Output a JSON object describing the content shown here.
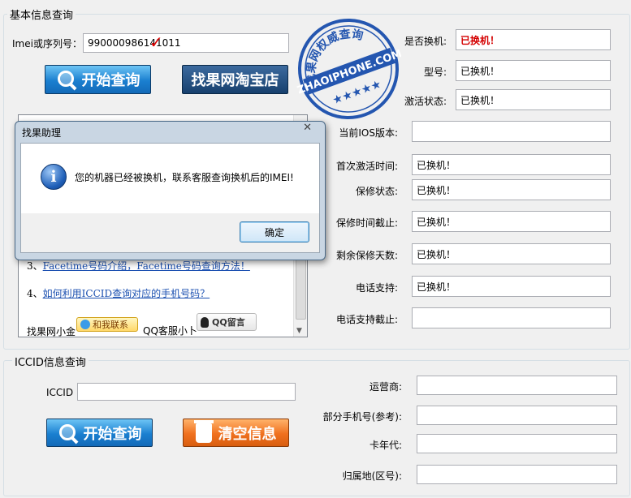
{
  "basic_group": {
    "title": "基本信息查询",
    "imei_label": "Imei或序列号：",
    "imei_value": "990000986141011",
    "query_button": "开始查询",
    "taobao_button": "找果网淘宝店",
    "stamp_text": "找果网权威查询",
    "stamp_site": "ZHAOIPHONE.COM",
    "stamp_stars": "★★★★★",
    "fields": [
      {
        "label": "是否换机:",
        "value": "已换机！",
        "highlight": true
      },
      {
        "label": "型号:",
        "value": "已换机！"
      },
      {
        "label": "激活状态:",
        "value": "已换机！"
      },
      {
        "label": "当前IOS版本:",
        "value": ""
      },
      {
        "label": "首次激活时间:",
        "value": "已换机！"
      },
      {
        "label": "保修状态:",
        "value": "已换机！"
      },
      {
        "label": "保修时间截止:",
        "value": "已换机！"
      },
      {
        "label": "剩余保修天数:",
        "value": "已换机！"
      },
      {
        "label": "电话支持:",
        "value": "已换机！"
      },
      {
        "label": "电话支持截止:",
        "value": ""
      }
    ],
    "links": [
      {
        "prefix": "3、",
        "text": "Facetime号码介绍，Facetime号码查询方法！"
      },
      {
        "prefix": "4、",
        "text": "如何利用ICCID查询对应的手机号码？"
      }
    ],
    "helper_label": "找果网小金",
    "contact_button": "和我联系",
    "qq_label": "QQ客服小卜",
    "qq_button": "QQ留言"
  },
  "dialog": {
    "title": "找果助理",
    "close": "✕",
    "message": "您的机器已经被换机，联系客服查询换机后的IMEI!",
    "ok": "确定",
    "icon": "info-icon"
  },
  "iccid_group": {
    "title": "ICCID信息查询",
    "iccid_label": "ICCID",
    "iccid_value": "",
    "query_button": "开始查询",
    "clear_button": "清空信息",
    "fields": [
      {
        "label": "运营商:",
        "value": ""
      },
      {
        "label": "部分手机号(参考):",
        "value": ""
      },
      {
        "label": "卡年代:",
        "value": ""
      },
      {
        "label": "归属地(区号):",
        "value": ""
      }
    ]
  },
  "colors": {
    "accent_red": "#d40000",
    "link_blue": "#1a4fb0",
    "stamp_blue": "#2456b0"
  }
}
